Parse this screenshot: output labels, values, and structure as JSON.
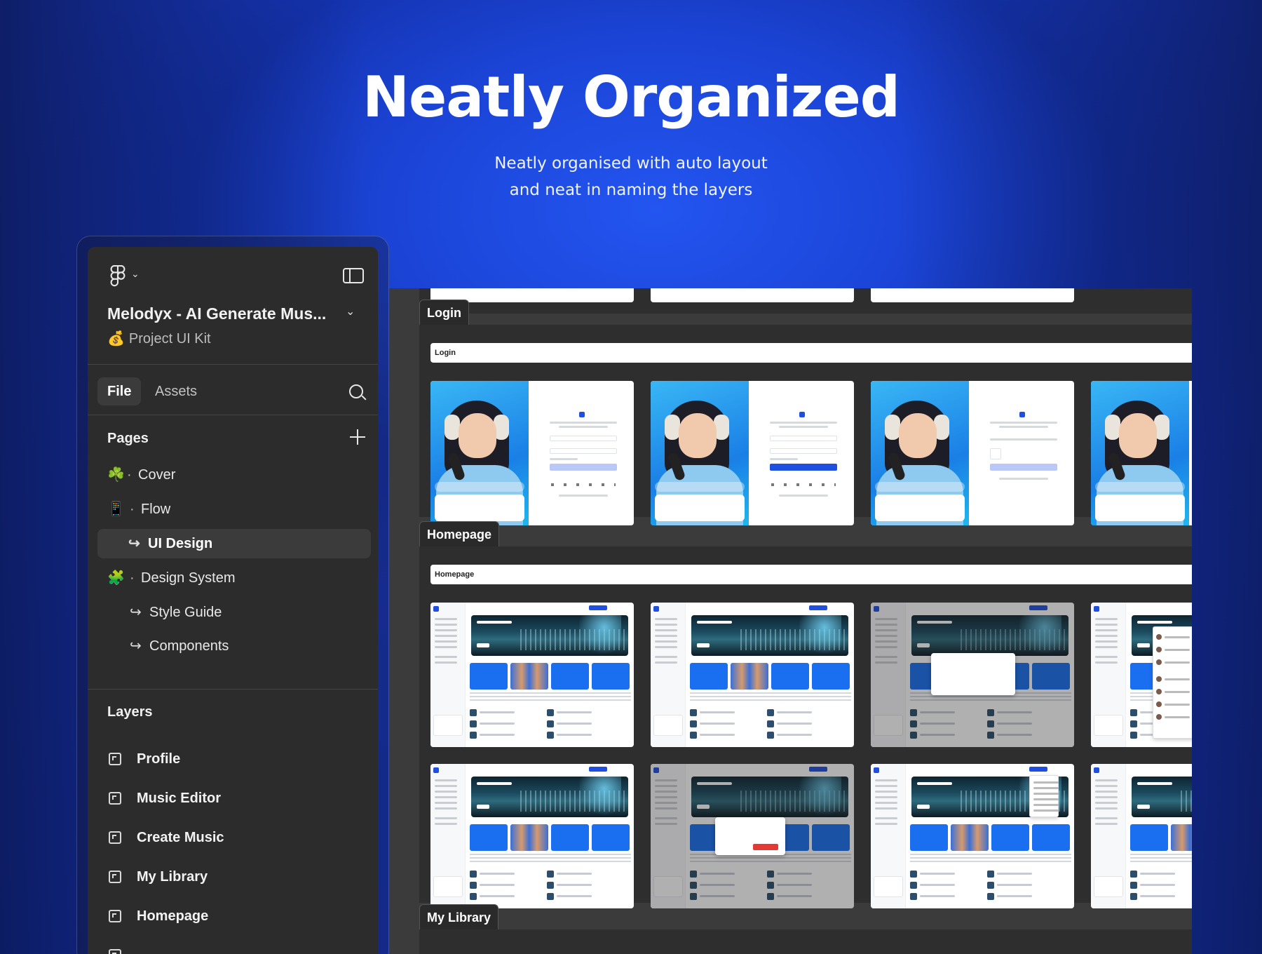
{
  "hero": {
    "title": "Neatly Organized",
    "subtitle_line1": "Neatly organised with auto layout",
    "subtitle_line2": "and neat in naming the layers"
  },
  "sidebar": {
    "project_title": "Melodyx - AI Generate Mus...",
    "project_subtitle": "Project UI Kit",
    "tabs": {
      "file": "File",
      "assets": "Assets"
    },
    "pages_heading": "Pages",
    "pages": [
      {
        "label": "Cover",
        "emoji": "☘️"
      },
      {
        "label": "Flow",
        "emoji": "📱"
      },
      {
        "label": "UI Design",
        "active": true
      },
      {
        "label": "Design System",
        "emoji": "🧩"
      },
      {
        "label": "Style Guide"
      },
      {
        "label": "Components"
      }
    ],
    "layers_heading": "Layers",
    "layers": [
      "Profile",
      "Music Editor",
      "Create Music",
      "My Library",
      "Homepage"
    ]
  },
  "canvas": {
    "sections": {
      "login": {
        "tab_label": "Login",
        "header": "Login"
      },
      "homepage": {
        "tab_label": "Homepage",
        "header": "Homepage"
      },
      "my_library": {
        "tab_label": "My Library"
      }
    }
  },
  "colors": {
    "accent": "#1f4fe0",
    "panel_bg": "#2c2c2c",
    "canvas_bg": "#3b3b3b",
    "hero_bg": "#1b44d6"
  }
}
